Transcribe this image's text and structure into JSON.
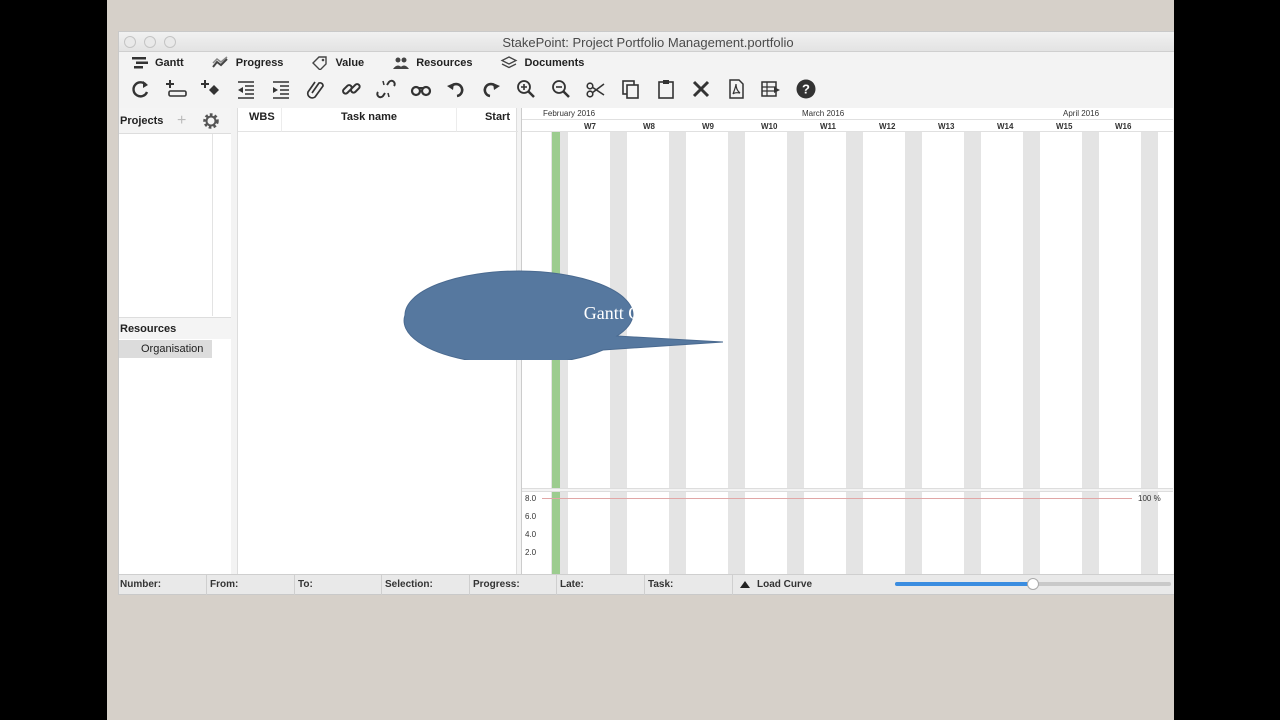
{
  "window": {
    "title": "StakePoint:  Project Portfolio Management.portfolio"
  },
  "tabs": [
    {
      "label": "Gantt",
      "icon": "gantt-icon"
    },
    {
      "label": "Progress",
      "icon": "progress-icon"
    },
    {
      "label": "Value",
      "icon": "value-tag-icon"
    },
    {
      "label": "Resources",
      "icon": "resources-icon"
    },
    {
      "label": "Documents",
      "icon": "documents-icon"
    }
  ],
  "toolbar": [
    "refresh-icon",
    "add-task-icon",
    "add-milestone-icon",
    "outdent-icon",
    "indent-icon",
    "attach-icon",
    "link-icon",
    "unlink-icon",
    "find-icon",
    "undo-icon",
    "redo-icon",
    "zoom-in-icon",
    "zoom-out-icon",
    "cut-icon",
    "copy-icon",
    "paste-icon",
    "delete-icon",
    "pdf-icon",
    "export-icon",
    "help-icon"
  ],
  "left_panel": {
    "projects_label": "Projects",
    "resources_label": "Resources",
    "organisation_label": "Organisation"
  },
  "task_table": {
    "columns": [
      "WBS",
      "Task name",
      "Start"
    ]
  },
  "gantt": {
    "months": [
      "February  2016",
      "March  2016",
      "April  2016"
    ],
    "weeks": [
      "W7",
      "W8",
      "W9",
      "W10",
      "W11",
      "W12",
      "W13",
      "W14",
      "W15",
      "W16"
    ],
    "today_color": "#9ccc8f"
  },
  "load_chart": {
    "y_labels": [
      "8.0",
      "6.0",
      "4.0",
      "2.0"
    ],
    "limit_label": "100 %"
  },
  "statusbar": {
    "fields": [
      "Number:",
      "From:",
      "To:",
      "Selection:",
      "Progress:",
      "Late:",
      "Task:"
    ],
    "load_curve_label": "Load Curve",
    "slider_value": 0.5
  },
  "callout": {
    "text": "Gantt Chart",
    "color": "#56789f"
  }
}
